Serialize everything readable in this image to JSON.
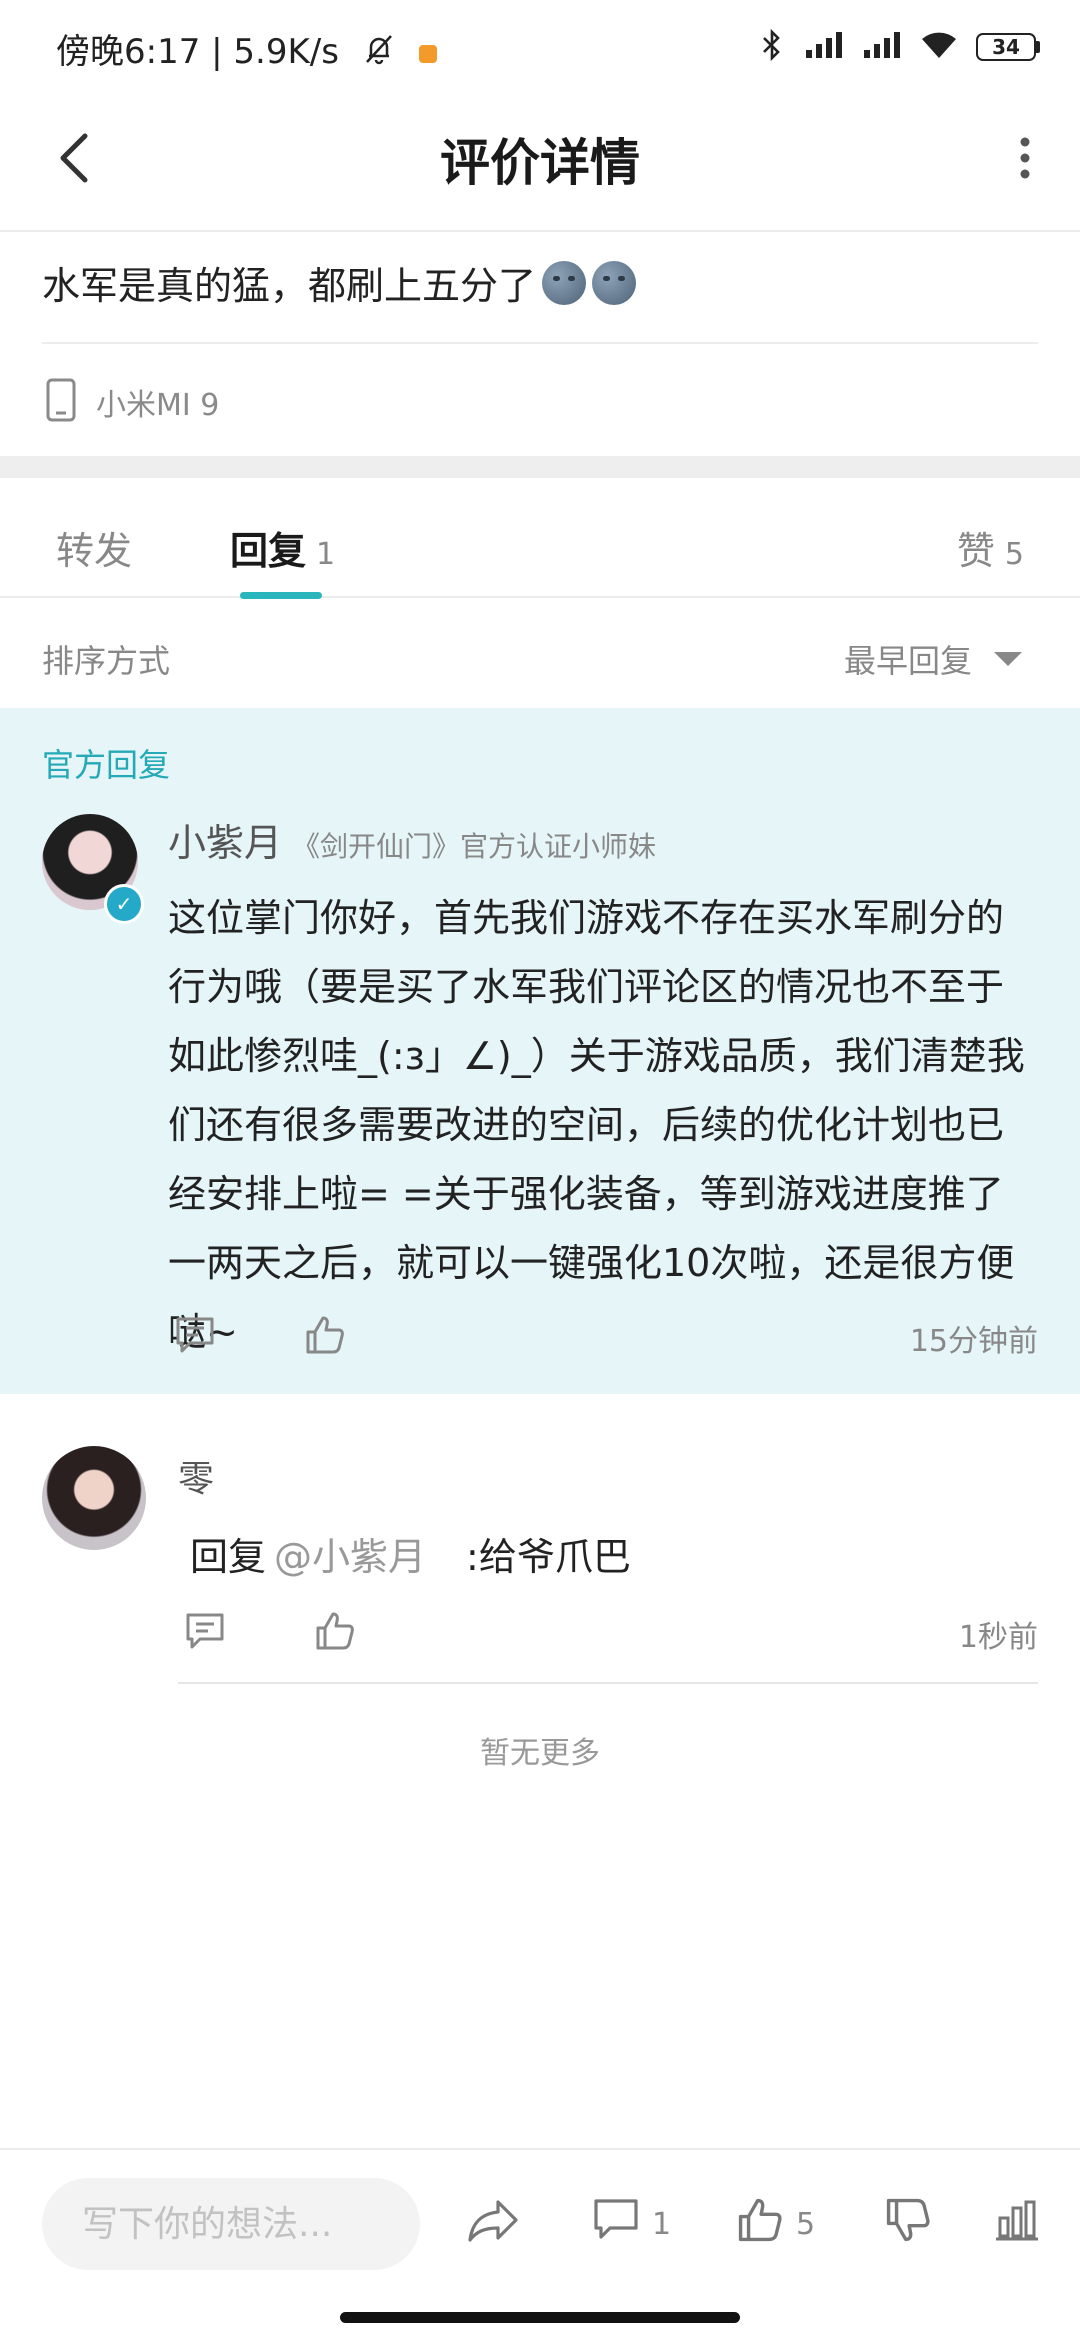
{
  "status_bar": {
    "time_speed": "傍晚6:17 | 5.9K/s",
    "battery": "34"
  },
  "header": {
    "title": "评价详情"
  },
  "review": {
    "text": "水军是真的猛，都刷上五分了",
    "device": "小米MI 9"
  },
  "tabs": [
    {
      "label": "转发"
    },
    {
      "label": "回复",
      "count": "1"
    },
    {
      "label": "赞",
      "count": "5"
    }
  ],
  "sort": {
    "label": "排序方式",
    "selected": "最早回复"
  },
  "official_reply": {
    "section_label": "官方回复",
    "name": "小紫月",
    "tag": "《剑开仙门》官方认证小师妹",
    "content": "这位掌门你好，首先我们游戏不存在买水军刷分的行为哦（要是买了水军我们评论区的情况也不至于如此惨烈哇_(:з」∠)_）关于游戏品质，我们清楚我们还有很多需要改进的空间，后续的优化计划也已经安排上啦= =关于强化装备，等到游戏进度推了一两天之后，就可以一键强化10次啦，还是很方便哒~",
    "time": "15分钟前"
  },
  "user_reply": {
    "name": "零",
    "prefix": "回复",
    "mention": "@小紫月",
    "text": ":给爷爪巴",
    "time": "1秒前"
  },
  "footer_note": "暂无更多",
  "bottom_bar": {
    "input_placeholder": "写下你的想法...",
    "comment_count": "1",
    "like_count": "5"
  },
  "colors": {
    "accent": "#2bb6bd",
    "official_bg": "#e5f5f8",
    "official_label": "#25a9b6"
  }
}
